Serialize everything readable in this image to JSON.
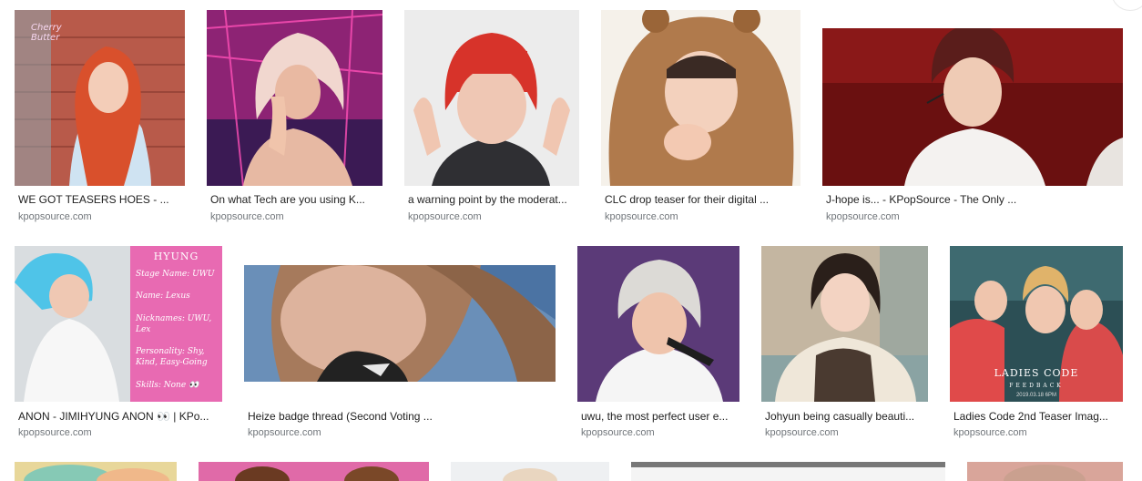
{
  "results": [
    {
      "title": "WE GOT TEASERS HOES - ...",
      "source": "kpopsource.com"
    },
    {
      "title": "On what Tech are you using K...",
      "source": "kpopsource.com"
    },
    {
      "title": "a warning point by the moderat...",
      "source": "kpopsource.com"
    },
    {
      "title": "CLC drop teaser for their digital ...",
      "source": "kpopsource.com"
    },
    {
      "title": "J-hope is... - KPopSource - The Only ...",
      "source": "kpopsource.com"
    },
    {
      "title": "ANON - JIMIHYUNG ANON 👀 | KPo...",
      "source": "kpopsource.com"
    },
    {
      "title": "Heize badge thread (Second Voting ...",
      "source": "kpopsource.com"
    },
    {
      "title": "uwu, the most perfect user e...",
      "source": "kpopsource.com"
    },
    {
      "title": "Johyun being casually beauti...",
      "source": "kpopsource.com"
    },
    {
      "title": "Ladies Code 2nd Teaser Imag...",
      "source": "kpopsource.com"
    }
  ],
  "image_text": {
    "hyung_card": {
      "heading": "HYUNG",
      "lines": [
        "Stage Name: UWU",
        "Name: Lexus",
        "Nicknames: UWU,",
        "Lex",
        "Personality: Shy,",
        "Kind, Easy-Going",
        "Skills: None 👀"
      ]
    },
    "ladies_code_card": {
      "logo": "LADIES CODE",
      "sub": "FEEDBACK",
      "date": "2019.03.18 6PM"
    },
    "first_card_logo": "Cherry Butter"
  }
}
